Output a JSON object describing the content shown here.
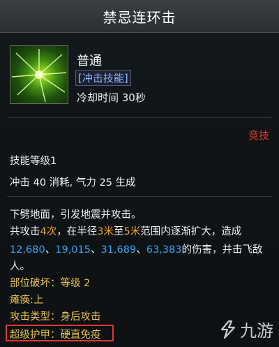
{
  "window": {
    "title": "禁忌连环击"
  },
  "skill": {
    "name": "普通",
    "type": "[冲击技能]",
    "cooldown": "冷却时间 30秒",
    "pvp_tag": "竞技",
    "level": "技能等级1",
    "cost": "冲击 40 消耗, 气力 25 生成"
  },
  "description": {
    "line1": "下劈地面，引发地震并攻击。",
    "line2_pre": "共攻击",
    "line2_hits": "4次",
    "line2_mid1": "，在半径",
    "line2_r1": "3米",
    "line2_mid2": "至",
    "line2_r2": "5米",
    "line2_post": "范围内逐渐扩大，造成",
    "dmg1": "12,680",
    "dmg2": "19,015",
    "dmg3": "31,689",
    "dmg4": "63,383",
    "sep": "、",
    "line3_post": "的伤害，并击飞敌",
    "line4": "人。"
  },
  "effects": {
    "part_break_label": "部位破坏：",
    "part_break_value": "等级 2",
    "paralysis_label": "瘫痪:",
    "paralysis_value": "上",
    "attack_type_label": "攻击类型：",
    "attack_type_value": "身后攻击",
    "super_armor_label": "超级护甲：",
    "super_armor_value": "硬直免疫"
  },
  "watermark": {
    "text": "九游"
  },
  "colors": {
    "accent_blue": "#2fa7f0",
    "accent_orange": "#f2a125",
    "pvp_red": "#e23a2a",
    "highlight_box": "#e13838"
  }
}
